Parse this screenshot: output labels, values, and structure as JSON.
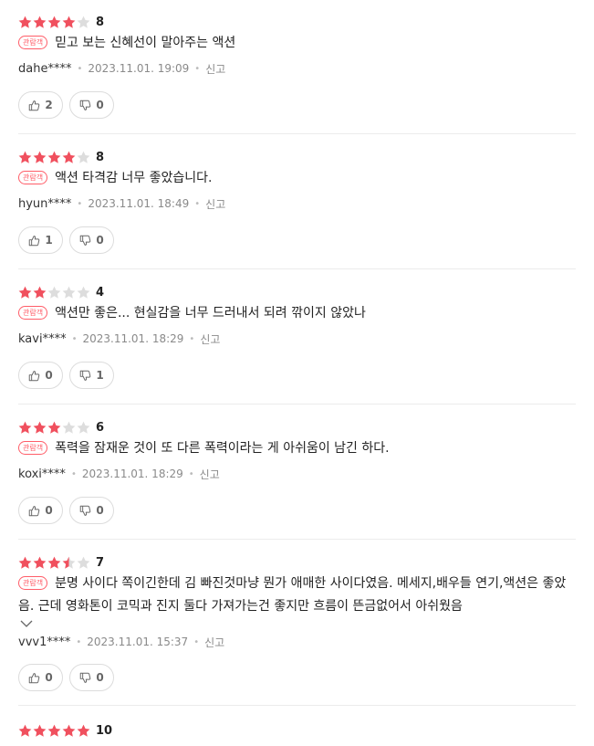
{
  "badge_label": "관람객",
  "report_label": "신고",
  "colors": {
    "star_on": "#f0505e",
    "star_off": "#dddddd",
    "badge": "#ff5d68"
  },
  "reviews": [
    {
      "stars": 4,
      "score": "8",
      "content": "믿고 보는 신혜선이 말아주는 액션",
      "author": "dahe****",
      "date": "2023.11.01. 19:09",
      "likes": "2",
      "dislikes": "0"
    },
    {
      "stars": 4,
      "score": "8",
      "content": "액션 타격감 너무 좋았습니다.",
      "author": "hyun****",
      "date": "2023.11.01. 18:49",
      "likes": "1",
      "dislikes": "0"
    },
    {
      "stars": 2,
      "score": "4",
      "content": "액션만 좋은... 현실감을 너무 드러내서 되려 깎이지 않았나",
      "author": "kavi****",
      "date": "2023.11.01. 18:29",
      "likes": "0",
      "dislikes": "1"
    },
    {
      "stars": 3,
      "score": "6",
      "content": "폭력을 잠재운 것이 또 다른 폭력이라는 게 아쉬움이 남긴 하다.",
      "author": "koxi****",
      "date": "2023.11.01. 18:29",
      "likes": "0",
      "dislikes": "0"
    },
    {
      "stars": 3.5,
      "score": "7",
      "content": "분명 사이다 쪽이긴한데 김 빠진것마냥 뭔가 애매한 사이다였음. 메세지,배우들 연기,액션은 좋았음. 근데 영화톤이 코믹과 진지 둘다 가져가는건 좋지만 흐름이 뜬금없어서 아쉬웠음",
      "author": "vvv1****",
      "date": "2023.11.01. 15:37",
      "likes": "0",
      "dislikes": "0"
    },
    {
      "stars": 5,
      "score": "10"
    }
  ]
}
